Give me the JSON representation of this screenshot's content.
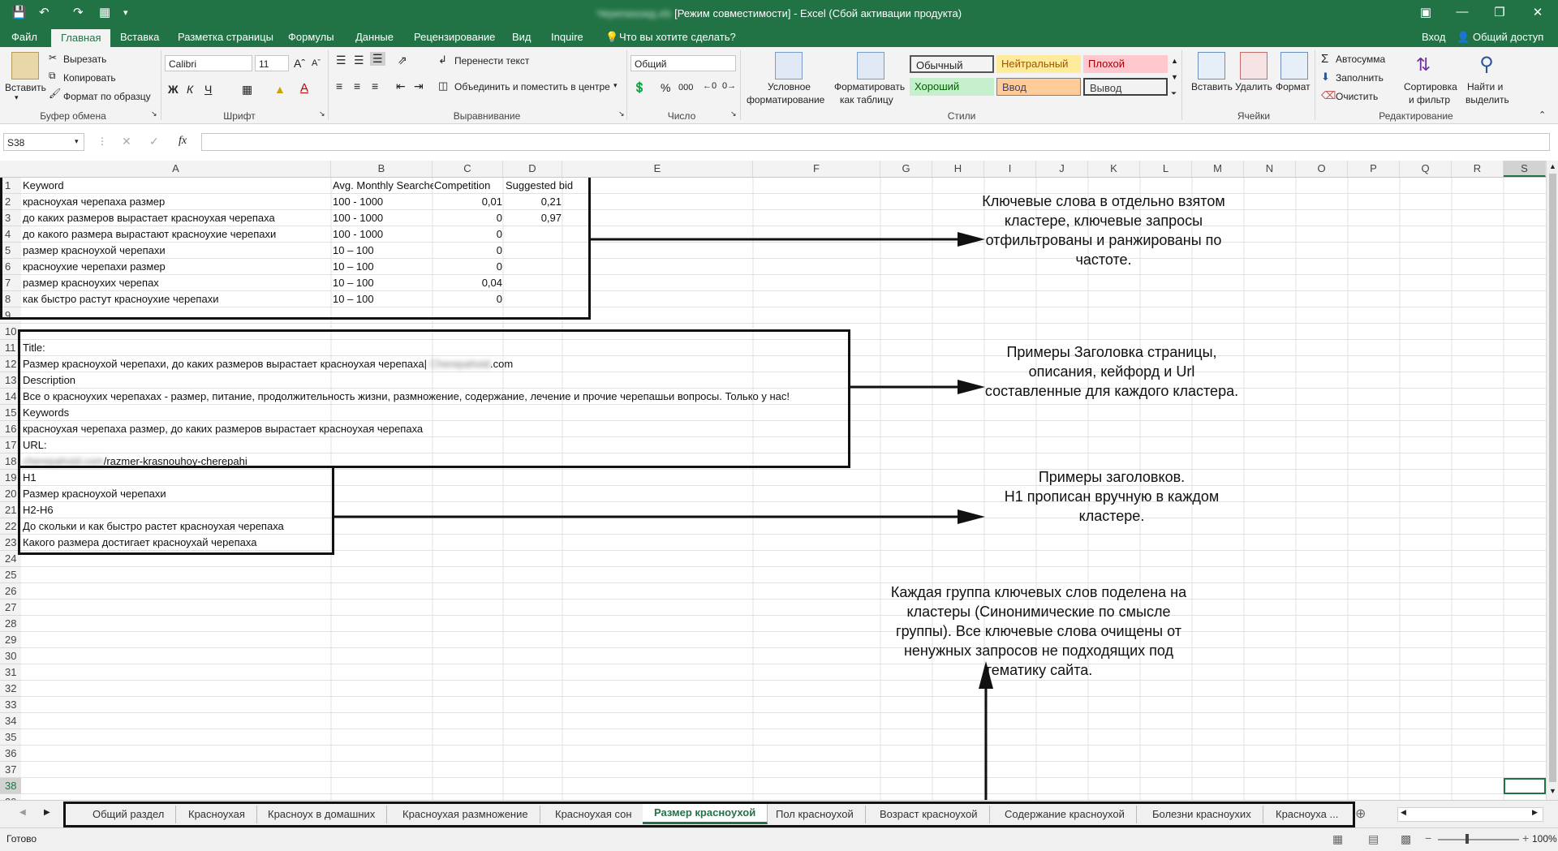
{
  "app": {
    "title_blurred": "Черепахоид.xls",
    "title_suffix": "[Режим совместимости] - Excel (Сбой активации продукта)",
    "login": "Вход",
    "share": "Общий доступ"
  },
  "ribbon_tabs": [
    "Файл",
    "Главная",
    "Вставка",
    "Разметка страницы",
    "Формулы",
    "Данные",
    "Рецензирование",
    "Вид",
    "Inquire"
  ],
  "tell_me": "Что вы хотите сделать?",
  "clipboard": {
    "paste": "Вставить",
    "cut": "Вырезать",
    "copy": "Копировать",
    "format_painter": "Формат по образцу",
    "group": "Буфер обмена"
  },
  "font": {
    "name": "Calibri",
    "size": "11",
    "bold": "Ж",
    "italic": "К",
    "underline": "Ч",
    "group": "Шрифт"
  },
  "alignment": {
    "wrap": "Перенести текст",
    "merge": "Объединить и поместить в центре",
    "group": "Выравнивание"
  },
  "number": {
    "format": "Общий",
    "group": "Число"
  },
  "styles": {
    "conditional": [
      "Условное",
      "форматирование"
    ],
    "as_table": [
      "Форматировать",
      "как таблицу"
    ],
    "cells": [
      {
        "label": "Обычный",
        "bg": "#ffffff",
        "color": "#000000"
      },
      {
        "label": "Нейтральный",
        "bg": "#ffeb9c",
        "color": "#9c5700"
      },
      {
        "label": "Плохой",
        "bg": "#ffc7ce",
        "color": "#9c0006"
      },
      {
        "label": "Хороший",
        "bg": "#c6efce",
        "color": "#006100"
      },
      {
        "label": "Ввод",
        "bg": "#ffcc99",
        "color": "#3f3f76"
      },
      {
        "label": "Вывод",
        "bg": "#f2f2f2",
        "color": "#3f3f3f"
      }
    ],
    "group": "Стили"
  },
  "cells_group": {
    "insert": "Вставить",
    "delete": "Удалить",
    "format": "Формат",
    "group": "Ячейки"
  },
  "editing": {
    "autosum": "Автосумма",
    "fill": "Заполнить",
    "clear": "Очистить",
    "sort": [
      "Сортировка",
      "и фильтр"
    ],
    "find": [
      "Найти и",
      "выделить"
    ],
    "group": "Редактирование"
  },
  "formula_bar": {
    "name_box": "S38",
    "fx": "fx",
    "value": ""
  },
  "columns": [
    "A",
    "B",
    "C",
    "D",
    "E",
    "F",
    "G",
    "H",
    "I",
    "J",
    "K",
    "L",
    "M",
    "N",
    "O",
    "P",
    "Q",
    "R",
    "S"
  ],
  "rows": [
    "1",
    "2",
    "3",
    "4",
    "5",
    "6",
    "7",
    "8",
    "9",
    "10",
    "11",
    "12",
    "13",
    "14",
    "15",
    "16",
    "17",
    "18",
    "19",
    "20",
    "21",
    "22",
    "23",
    "24",
    "25",
    "26",
    "27",
    "28",
    "29",
    "30",
    "31",
    "32",
    "33",
    "34",
    "35",
    "36",
    "37",
    "38",
    "39"
  ],
  "table": {
    "headers": [
      "Keyword",
      "Avg. Monthly Searches",
      "Competition",
      "Suggested bid"
    ],
    "rows": [
      [
        "красноухая черепаха размер",
        "100 - 1000",
        "0,01",
        "0,21"
      ],
      [
        "до каких размеров вырастает красноухая черепаха",
        "100 - 1000",
        "0",
        "0,97"
      ],
      [
        "до какого размера вырастают красноухие черепахи",
        "100 - 1000",
        "0",
        ""
      ],
      [
        "размер красноухой черепахи",
        "10 – 100",
        "0",
        ""
      ],
      [
        "красноухие черепахи размер",
        "10 – 100",
        "0",
        ""
      ],
      [
        "размер красноухих черепах",
        "10 – 100",
        "0,04",
        ""
      ],
      [
        "как быстро растут красноухие черепахи",
        "10 – 100",
        "0",
        ""
      ]
    ]
  },
  "meta": {
    "title_label": "Title:",
    "title_value": "Размер красноухой черепахи, до каких размеров вырастает красноухая черепаха|",
    "title_domain_blur": "Cherepahoid",
    "title_domain_tld": ".com",
    "description_label": "Description",
    "description_value": "Все о красноухих черепахах - размер, питание, продолжительность жизни, размножение, содержание, лечение и прочие черепашьи вопросы. Только у нас!",
    "keywords_label": "Keywords",
    "keywords_value": "красноухая черепаха размер, до каких размеров вырастает красноухая черепаха",
    "url_label": "URL:",
    "url_blur": "cherepahoid.com",
    "url_path": "/razmer-krasnouhoy-cherepahi"
  },
  "headings": {
    "h1_label": "H1",
    "h1_value": "Размер красноухой черепахи",
    "h2_label": "H2-H6",
    "h2_values": [
      "До скольки и как быстро растет красноухая черепаха",
      "Какого размера достигает красноухай черепаха"
    ]
  },
  "notes": {
    "n1": [
      "Ключевые слова в отдельно взятом",
      "кластере, ключевые запросы",
      "отфильтрованы и ранжированы по",
      "частоте."
    ],
    "n2": [
      "Примеры Заголовка страницы,",
      "описания, кейфорд и Url",
      "составленные для каждого кластера."
    ],
    "n3": [
      "Примеры заголовков.",
      "H1 прописан вручную в каждом",
      "кластере."
    ],
    "n4": [
      "Каждая группа ключевых слов поделена на",
      "кластеры (Синонимические по смысле",
      "группы). Все ключевые слова очищены от",
      "ненужных запросов не подходящих под",
      "тематику сайта."
    ]
  },
  "sheet_tabs": [
    "Общий раздел",
    "Красноухая",
    "Красноух в домашних",
    "Красноухая размножение",
    "Красноухая сон",
    "Размер красноухой",
    "Пол красноухой",
    "Возраст красноухой",
    "Содержание красноухой",
    "Болезни красноухих",
    "Красноуха ..."
  ],
  "active_sheet": "Размер красноухой",
  "status": {
    "ready": "Готово",
    "zoom": "100%"
  },
  "colors": {
    "accent": "#217346",
    "ribbon_bg": "#f3f3f3"
  }
}
